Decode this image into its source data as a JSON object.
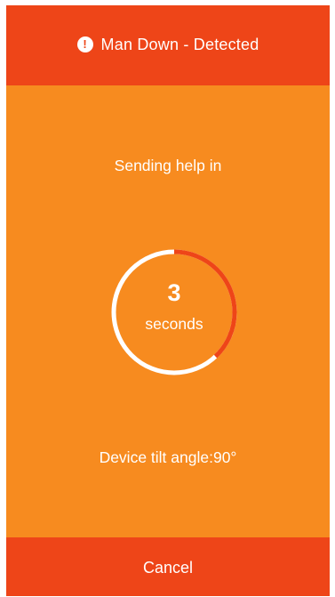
{
  "header": {
    "icon": "exclamation-circle-icon",
    "title": "Man Down - Detected"
  },
  "countdown": {
    "prompt": "Sending help in",
    "value": "3",
    "unit": "seconds",
    "elapsed_fraction": 0.38
  },
  "status": {
    "tilt_text": "Device tilt angle:90°"
  },
  "footer": {
    "cancel_label": "Cancel"
  },
  "colors": {
    "background": "#f78b1f",
    "accent": "#ee4518",
    "text": "#ffffff"
  }
}
